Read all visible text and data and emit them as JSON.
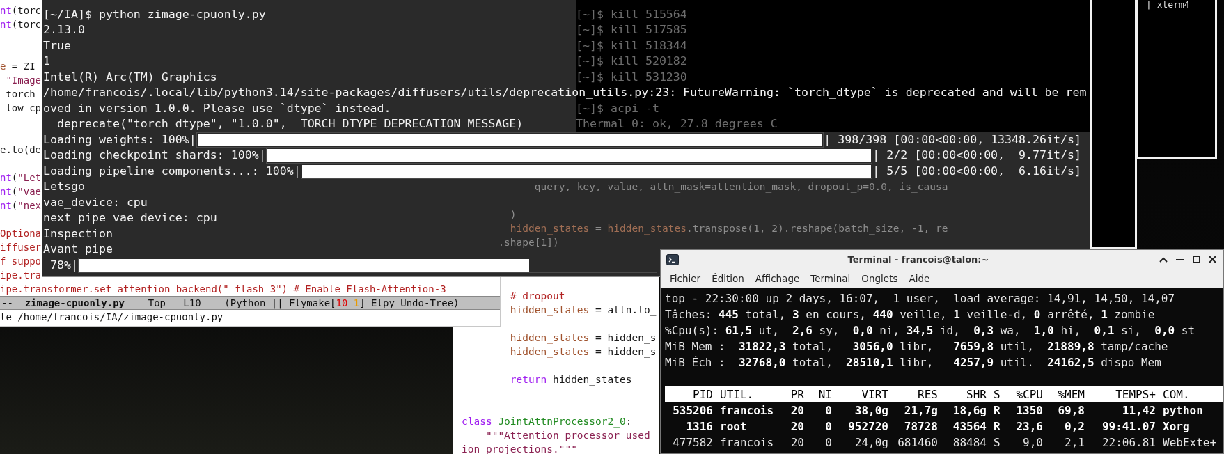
{
  "emacs": {
    "lines": [
      {
        "kind": "code",
        "segments": [
          {
            "kind": "builtin",
            "text": "nt"
          },
          {
            "kind": "plain",
            "text": "(torc"
          }
        ]
      },
      {
        "kind": "code",
        "segments": [
          {
            "kind": "builtin",
            "text": "nt"
          },
          {
            "kind": "plain",
            "text": "(torc"
          }
        ]
      },
      {
        "kind": "blank"
      },
      {
        "kind": "blank"
      },
      {
        "kind": "code",
        "segments": [
          {
            "kind": "var",
            "text": "e"
          },
          {
            "kind": "plain",
            "text": " = ZI"
          }
        ]
      },
      {
        "kind": "code",
        "segments": [
          {
            "kind": "string",
            "text": " \"Image"
          }
        ]
      },
      {
        "kind": "code",
        "segments": [
          {
            "kind": "plain",
            "text": " torch_"
          }
        ]
      },
      {
        "kind": "code",
        "segments": [
          {
            "kind": "plain",
            "text": " low_cp"
          }
        ]
      },
      {
        "kind": "blank"
      },
      {
        "kind": "blank"
      },
      {
        "kind": "code",
        "segments": [
          {
            "kind": "plain",
            "text": "e.to(de"
          }
        ]
      },
      {
        "kind": "blank"
      },
      {
        "kind": "code",
        "segments": [
          {
            "kind": "builtin",
            "text": "nt"
          },
          {
            "kind": "plain",
            "text": "("
          },
          {
            "kind": "string",
            "text": "\"Let"
          }
        ]
      },
      {
        "kind": "code",
        "segments": [
          {
            "kind": "builtin",
            "text": "nt"
          },
          {
            "kind": "plain",
            "text": "("
          },
          {
            "kind": "string",
            "text": "\"vae"
          }
        ]
      },
      {
        "kind": "code",
        "segments": [
          {
            "kind": "builtin",
            "text": "nt"
          },
          {
            "kind": "plain",
            "text": "("
          },
          {
            "kind": "string",
            "text": "\"nex"
          }
        ]
      },
      {
        "kind": "blank"
      },
      {
        "kind": "code",
        "segments": [
          {
            "kind": "comment",
            "text": "Optiona"
          }
        ]
      },
      {
        "kind": "code",
        "segments": [
          {
            "kind": "comment",
            "text": "iffuser"
          }
        ]
      },
      {
        "kind": "code",
        "segments": [
          {
            "kind": "comment",
            "text": "f suppo"
          }
        ]
      },
      {
        "kind": "code",
        "segments": [
          {
            "kind": "comment",
            "text": "ipe.tra"
          }
        ]
      },
      {
        "kind": "code",
        "segments": [
          {
            "kind": "comment",
            "text": "ipe.transformer.set_attention_backend(\"_flash_3\") # Enable Flash-Attention-3"
          }
        ]
      }
    ],
    "mode_line": {
      "prefix": "--",
      "buffer": "zimage-cpuonly.py",
      "position": "Top",
      "line": "L10",
      "modes_before": "(Python || Flymake[",
      "errors": "10",
      "warnings": "1",
      "modes_after": "] Elpy Undo-Tree)"
    },
    "minibuffer": "te /home/francois/IA/zimage-cpuonly.py"
  },
  "code_editor": {
    "lines": [
      {
        "kind": "blank"
      },
      {
        "kind": "code",
        "segments": [
          {
            "kind": "comment",
            "text": "        # dropout"
          }
        ]
      },
      {
        "kind": "code",
        "segments": [
          {
            "kind": "var",
            "text": "        hidden_states"
          },
          {
            "kind": "plain",
            "text": " = attn.to_"
          }
        ]
      },
      {
        "kind": "blank"
      },
      {
        "kind": "code",
        "segments": [
          {
            "kind": "var",
            "text": "        hidden_states"
          },
          {
            "kind": "plain",
            "text": " = hidden_s"
          }
        ]
      },
      {
        "kind": "code",
        "segments": [
          {
            "kind": "var",
            "text": "        hidden_states"
          },
          {
            "kind": "plain",
            "text": " = hidden_s"
          }
        ]
      },
      {
        "kind": "blank"
      },
      {
        "kind": "code",
        "segments": [
          {
            "kind": "keyword",
            "text": "        return"
          },
          {
            "kind": "plain",
            "text": " hidden_states"
          }
        ]
      },
      {
        "kind": "blank"
      },
      {
        "kind": "blank"
      },
      {
        "kind": "code",
        "segments": [
          {
            "kind": "keyword",
            "text": "class"
          },
          {
            "kind": "type",
            "text": " JointAttnProcessor2_0"
          },
          {
            "kind": "plain",
            "text": ":"
          }
        ]
      },
      {
        "kind": "code",
        "segments": [
          {
            "kind": "string",
            "text": "    \"\"\"Attention processor used"
          }
        ]
      },
      {
        "kind": "code",
        "segments": [
          {
            "kind": "string",
            "text": "ion projections.\"\"\""
          }
        ]
      }
    ]
  },
  "terminal": {
    "lines": [
      {
        "kind": "text",
        "text": "[~/IA]$ python zimage-cpuonly.py"
      },
      {
        "kind": "text",
        "text": "2.13.0"
      },
      {
        "kind": "text",
        "text": "True"
      },
      {
        "kind": "text",
        "text": "1"
      },
      {
        "kind": "text",
        "text": "Intel(R) Arc(TM) Graphics"
      },
      {
        "kind": "text",
        "text": "/home/francois/.local/lib/python3.14/site-packages/diffusers/utils/deprecation_utils.py:23: FutureWarning: `torch_dtype` is deprecated and will be rem"
      },
      {
        "kind": "text",
        "text": "oved in version 1.0.0. Please use `dtype` instead."
      },
      {
        "kind": "text",
        "text": "  deprecate(\"torch_dtype\", \"1.0.0\", _TORCH_DTYPE_DEPRECATION_MESSAGE)"
      },
      {
        "kind": "progress",
        "label": "Loading weights: 100%|",
        "level": 1,
        "stats": "| 398/398 [00:00<00:00, 13348.26it/s]"
      },
      {
        "kind": "progress",
        "label": "Loading checkpoint shards: 100%|",
        "level": 1,
        "stats": "| 2/2 [00:00<00:00,  9.77it/s]"
      },
      {
        "kind": "progress",
        "label": "Loading pipeline components...: 100%|",
        "level": 1,
        "stats": "| 5/5 [00:00<00:00,  6.16it/s]"
      },
      {
        "kind": "text",
        "text": "Letsgo"
      },
      {
        "kind": "text",
        "text": "vae_device: cpu"
      },
      {
        "kind": "text",
        "text": "next pipe vae device: cpu"
      },
      {
        "kind": "text",
        "text": "Inspection"
      },
      {
        "kind": "text",
        "text": "Avant pipe"
      },
      {
        "kind": "progress",
        "label": " 78%|",
        "level": 0.78
      }
    ],
    "background_terminal": {
      "lines": [
        {
          "kind": "text",
          "text": "[~]$ kill 515564"
        },
        {
          "kind": "text",
          "text": "[~]$ kill 517585"
        },
        {
          "kind": "text",
          "text": "[~]$ kill 518344"
        },
        {
          "kind": "text",
          "text": "[~]$ kill 520182"
        },
        {
          "kind": "text",
          "text": "[~]$ kill 531230"
        },
        {
          "kind": "blank"
        },
        {
          "kind": "text",
          "text": "[~]$ acpi -t"
        },
        {
          "kind": "text",
          "text": "Thermal 0: ok, 27.8 degrees C"
        }
      ]
    },
    "see_through_code": {
      "lines": [
        {
          "kind": "code",
          "segments": [
            {
              "kind": "plain",
              "text": "            query, key, value, attn_mask=attention_mask, dropout_p=0.0, is_causa"
            }
          ]
        },
        {
          "kind": "blank"
        },
        {
          "kind": "code",
          "segments": [
            {
              "kind": "plain",
              "text": "        )"
            }
          ]
        },
        {
          "kind": "code",
          "segments": [
            {
              "kind": "var",
              "text": "        hidden_states"
            },
            {
              "kind": "plain",
              "text": " = "
            },
            {
              "kind": "var",
              "text": "hidden_states"
            },
            {
              "kind": "plain",
              "text": ".transpose(1, 2).reshape(batch_size, -1, re"
            }
          ]
        },
        {
          "kind": "code",
          "segments": [
            {
              "kind": "plain",
              "text": "      .shape[1])"
            }
          ]
        }
      ]
    }
  },
  "xterm_label": "| xterm4",
  "terminal_window": {
    "title": "Terminal - francois@talon:~",
    "menu": [
      "Fichier",
      "Édition",
      "Affichage",
      "Terminal",
      "Onglets",
      "Aide"
    ],
    "summary": [
      "top - 22:30:00 up 2 days, 16:07,  1 user,  load average: 14,91, 14,50, 14,07",
      "Tâches: **445** total, **3** en cours, **440** veille, **1** veille-d, **0** arrêté, **1** zombie",
      "%Cpu(s): **61,5** ut,  **2,6** sy,  **0,0** ni, **34,5** id,  **0,3** wa,  **1,0** hi,  **0,1** si,  **0,0** st",
      "MiB Mem :  **31822,3** total,   **3056,0** libr,   **7659,8** util,  **21889,8** tamp/cache",
      "MiB Éch :  **32768,0** total,  **28510,1** libr,   **4257,9** util.  **24162,5** dispo Mem"
    ],
    "columns": [
      "PID",
      "UTIL.",
      "PR",
      "NI",
      "VIRT",
      "RES",
      "SHR",
      "S",
      "%CPU",
      "%MEM",
      "TEMPS+",
      "COM."
    ],
    "processes": [
      {
        "bold": true,
        "cells": [
          "535206",
          "francois",
          "20",
          "0",
          "38,0g",
          "21,7g",
          "18,6g",
          "R",
          "1350",
          "69,8",
          "11,42",
          "python"
        ]
      },
      {
        "bold": true,
        "cells": [
          "1316",
          "root",
          "20",
          "0",
          "952720",
          "78728",
          "43564",
          "R",
          "23,6",
          "0,2",
          "99:41.07",
          "Xorg"
        ]
      },
      {
        "bold": false,
        "cells": [
          "477582",
          "francois",
          "20",
          "0",
          "24,0g",
          "681460",
          "88484",
          "S",
          "9,0",
          "2,1",
          "22:06.81",
          "WebExte+"
        ]
      }
    ]
  }
}
